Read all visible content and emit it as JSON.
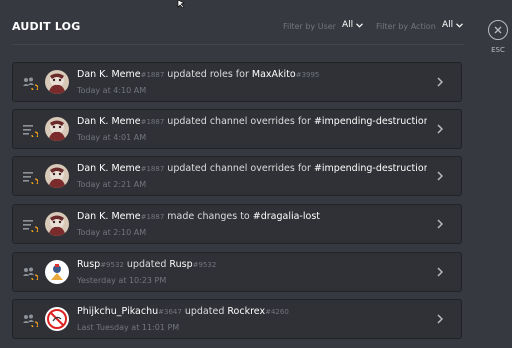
{
  "header": {
    "title": "AUDIT LOG",
    "filter_user_label": "Filter by User",
    "filter_user_value": "All",
    "filter_action_label": "Filter by Action",
    "filter_action_value": "All"
  },
  "close": {
    "label": "ESC"
  },
  "entries": [
    {
      "user": "Dan K. Meme",
      "user_disc": "#1887",
      "action": " updated roles for ",
      "target": "MaxAkito",
      "target_disc": "#3995",
      "time": "Today at 4:10 AM",
      "type": "member-update-icon",
      "avatar": "avatar-dan"
    },
    {
      "user": "Dan K. Meme",
      "user_disc": "#1887",
      "action": " updated channel overrides for ",
      "target": "#impending-destruction-...",
      "target_disc": "",
      "time": "Today at 4:01 AM",
      "type": "channel-overrides-icon",
      "avatar": "avatar-dan"
    },
    {
      "user": "Dan K. Meme",
      "user_disc": "#1887",
      "action": " updated channel overrides for ",
      "target": "#impending-destruction-...",
      "target_disc": "",
      "time": "Today at 2:21 AM",
      "type": "channel-overrides-icon",
      "avatar": "avatar-dan"
    },
    {
      "user": "Dan K. Meme",
      "user_disc": "#1887",
      "action": " made changes to ",
      "target": "#dragalia-lost",
      "target_disc": "",
      "time": "Today at 2:10 AM",
      "type": "channel-update-icon",
      "avatar": "avatar-dan"
    },
    {
      "user": "Rusp",
      "user_disc": "#9532",
      "action": " updated ",
      "target": "Rusp",
      "target_disc": "#9532",
      "time": "Yesterday at 10:23 PM",
      "type": "member-update-icon",
      "avatar": "avatar-rusp"
    },
    {
      "user": "Phijkchu_Pikachu",
      "user_disc": "#3647",
      "action": " updated ",
      "target": "Rockrex",
      "target_disc": "#4260",
      "time": "Last Tuesday at 11:01 PM",
      "type": "member-update-icon",
      "avatar": "avatar-phij"
    }
  ]
}
